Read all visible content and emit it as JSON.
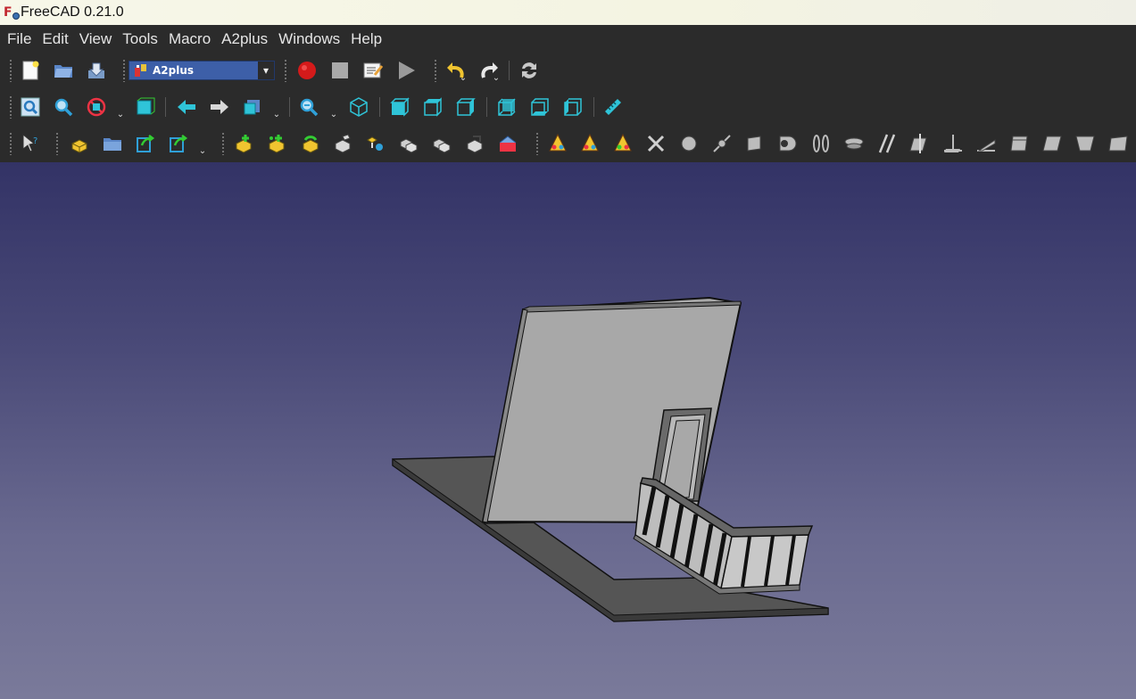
{
  "window": {
    "title": "FreeCAD 0.21.0"
  },
  "menu": [
    "File",
    "Edit",
    "View",
    "Tools",
    "Macro",
    "A2plus",
    "Windows",
    "Help"
  ],
  "workbench_selector": {
    "value": "A2plus"
  },
  "toolbar_icons": {
    "file": [
      "new-file-icon",
      "open-file-icon",
      "save-file-icon"
    ],
    "macro": [
      "record-macro-icon",
      "stop-macro-icon",
      "edit-macro-icon",
      "run-macro-icon"
    ],
    "edit": [
      "undo-icon",
      "redo-icon",
      "refresh-icon"
    ],
    "view": [
      "fit-all-icon",
      "fit-selection-icon",
      "draw-style-icon",
      "bounding-box-icon",
      "back-icon",
      "forward-icon",
      "sync-view-icon",
      "zoom-icon",
      "isometric-icon",
      "front-view-icon",
      "top-view-icon",
      "right-view-icon",
      "rear-view-icon",
      "bottom-view-icon",
      "left-view-icon",
      "measure-icon"
    ],
    "a2plus": [
      "selection-icon",
      "add-part-icon",
      "add-folder-icon",
      "import-part-icon",
      "import-shape-icon",
      "update-part-icon",
      "duplicate-part-icon",
      "convert-part-icon",
      "edit-part-icon",
      "solve-icon",
      "toggle-solver-icon",
      "delete-constraints-icon",
      "show-constraints-icon",
      "edit-constraint-icon",
      "flip-icon",
      "point-identity-icon",
      "point-on-line-icon",
      "point-on-plane-icon",
      "sphere-constraint-icon",
      "circular-edge-icon",
      "axis-coincident-icon",
      "axis-parallel-icon",
      "axis-plane-parallel-icon",
      "axis-plane-normal-icon",
      "axis-plane-angle-icon",
      "plane-parallel-icon",
      "plane-coincident-icon",
      "angled-planes-icon",
      "center-of-mass-icon"
    ]
  },
  "colors": {
    "viewport_top": "#333366",
    "viewport_bottom": "#7a7a9a",
    "model_face": "#a8a8a8",
    "model_floor": "#555555",
    "accent_cyan": "#2fc4d8",
    "record_red": "#d41a1a"
  }
}
